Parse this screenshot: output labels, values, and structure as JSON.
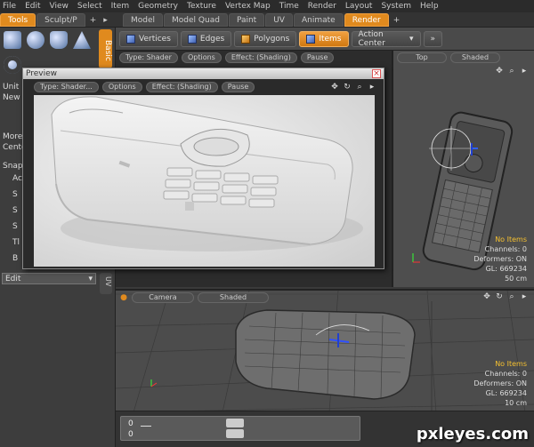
{
  "menu": [
    "File",
    "Edit",
    "View",
    "Select",
    "Item",
    "Geometry",
    "Texture",
    "Vertex Map",
    "Time",
    "Render",
    "Layout",
    "System",
    "Help"
  ],
  "left_tabs": [
    "Tools",
    "Sculpt/P"
  ],
  "main_tabs": [
    "Model",
    "Model Quad",
    "Paint",
    "UV",
    "Animate",
    "Render"
  ],
  "toolbar": {
    "vertices": "Vertices",
    "edges": "Edges",
    "polygons": "Polygons",
    "items": "Items",
    "action_center": "Action Center"
  },
  "left_panel": {
    "basic_tab": "Basic",
    "def_tab": "De",
    "unit_label": "Unit P",
    "new_label": "New",
    "more_label": "More",
    "center_label": "Cente",
    "snaps_label": "Snaps",
    "edit_select": "Edit",
    "uv_tab": "UV",
    "list_items": [
      "Ac",
      "S",
      "S",
      "S",
      "Tl",
      "B"
    ]
  },
  "viewport_top": {
    "pills": [
      "Type: Shader",
      "Options",
      "Effect: (Shading)",
      "Pause"
    ]
  },
  "viewport_tr": {
    "view": "Top",
    "shading": "Shaded",
    "info": [
      "No Items",
      "Channels: 0",
      "Deformers: ON",
      "GL: 669234",
      "50 cm"
    ]
  },
  "viewport_bottom": {
    "view": "Camera",
    "shading": "Shaded",
    "info": [
      "No Items",
      "Channels: 0",
      "Deformers: ON",
      "GL: 669234",
      "10 cm"
    ]
  },
  "preview": {
    "title": "Preview",
    "pills": [
      "Type: Shader...",
      "Options",
      "Effect: (Shading)",
      "Pause"
    ]
  },
  "timeline": {
    "value1": "0",
    "value2": "0"
  },
  "watermark": "pxleyes.com"
}
